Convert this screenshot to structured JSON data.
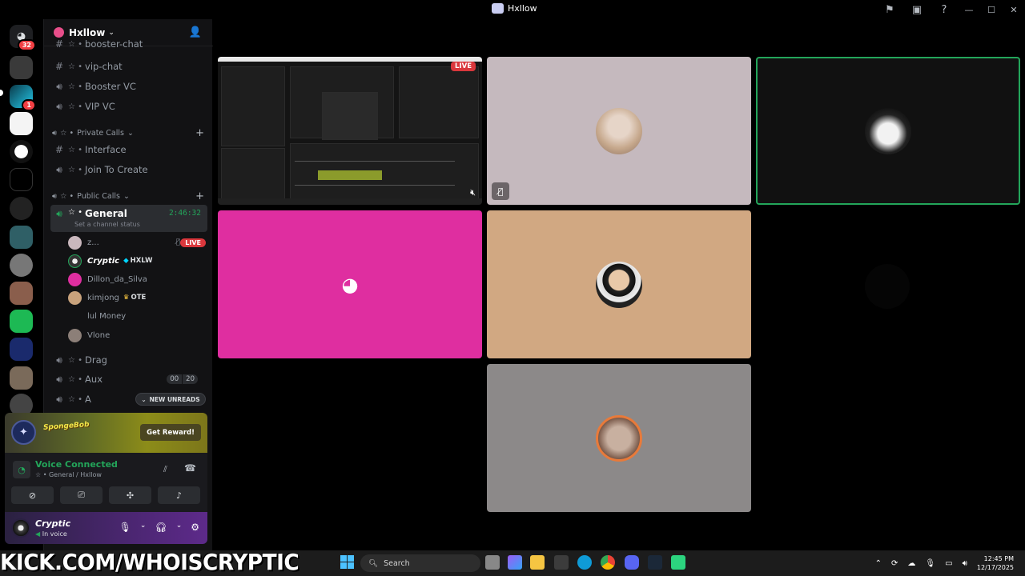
{
  "window": {
    "title": "Hxllow"
  },
  "rail": {
    "dm_badge": "32",
    "server_badge": "1"
  },
  "guild": {
    "name": "Hxllow"
  },
  "channels_top": [
    {
      "icon": "#",
      "name": "booster-chat"
    },
    {
      "icon": "#",
      "name": "vip-chat"
    },
    {
      "icon": "speaker",
      "name": "Booster VC"
    },
    {
      "icon": "speaker",
      "name": "VIP VC"
    }
  ],
  "categories": {
    "private": "Private Calls",
    "public": "Public Calls"
  },
  "private_channels": [
    {
      "icon": "#",
      "name": "Interface"
    },
    {
      "icon": "speaker",
      "name": "Join To Create"
    }
  ],
  "general": {
    "name": "General",
    "timer": "2:46:32",
    "status_placeholder": "Set a channel status"
  },
  "voice_users": [
    {
      "name": "z...",
      "live": "LIVE",
      "muted": true
    },
    {
      "name": "Cryptic",
      "tag": "HXLW"
    },
    {
      "name": "Dillon_da_Silva"
    },
    {
      "name": "kimjong",
      "tag": "OTE"
    },
    {
      "name": "lul Money"
    },
    {
      "name": "Vlone"
    }
  ],
  "channels_bottom": [
    {
      "name": "Drag"
    },
    {
      "name": "Aux",
      "count_a": "00",
      "count_b": "20"
    },
    {
      "name": "A"
    }
  ],
  "new_unreads": "NEW UNREADS",
  "promo": {
    "logo": "SpongeBob",
    "button": "Get Reward!"
  },
  "voice_panel": {
    "status": "Voice Connected",
    "location": "General / Hxllow"
  },
  "user_panel": {
    "name": "Cryptic",
    "status": "In voice"
  },
  "stream": {
    "live": "LIVE"
  },
  "overlay_text": "KICK.COM/WHOISCRYPTIC",
  "taskbar": {
    "search": "Search",
    "time": "12:45 PM",
    "date": "12/17/2025"
  },
  "colors": {
    "green": "#23a55a",
    "discord_tile": "#df2ea0",
    "live": "#da373c"
  }
}
